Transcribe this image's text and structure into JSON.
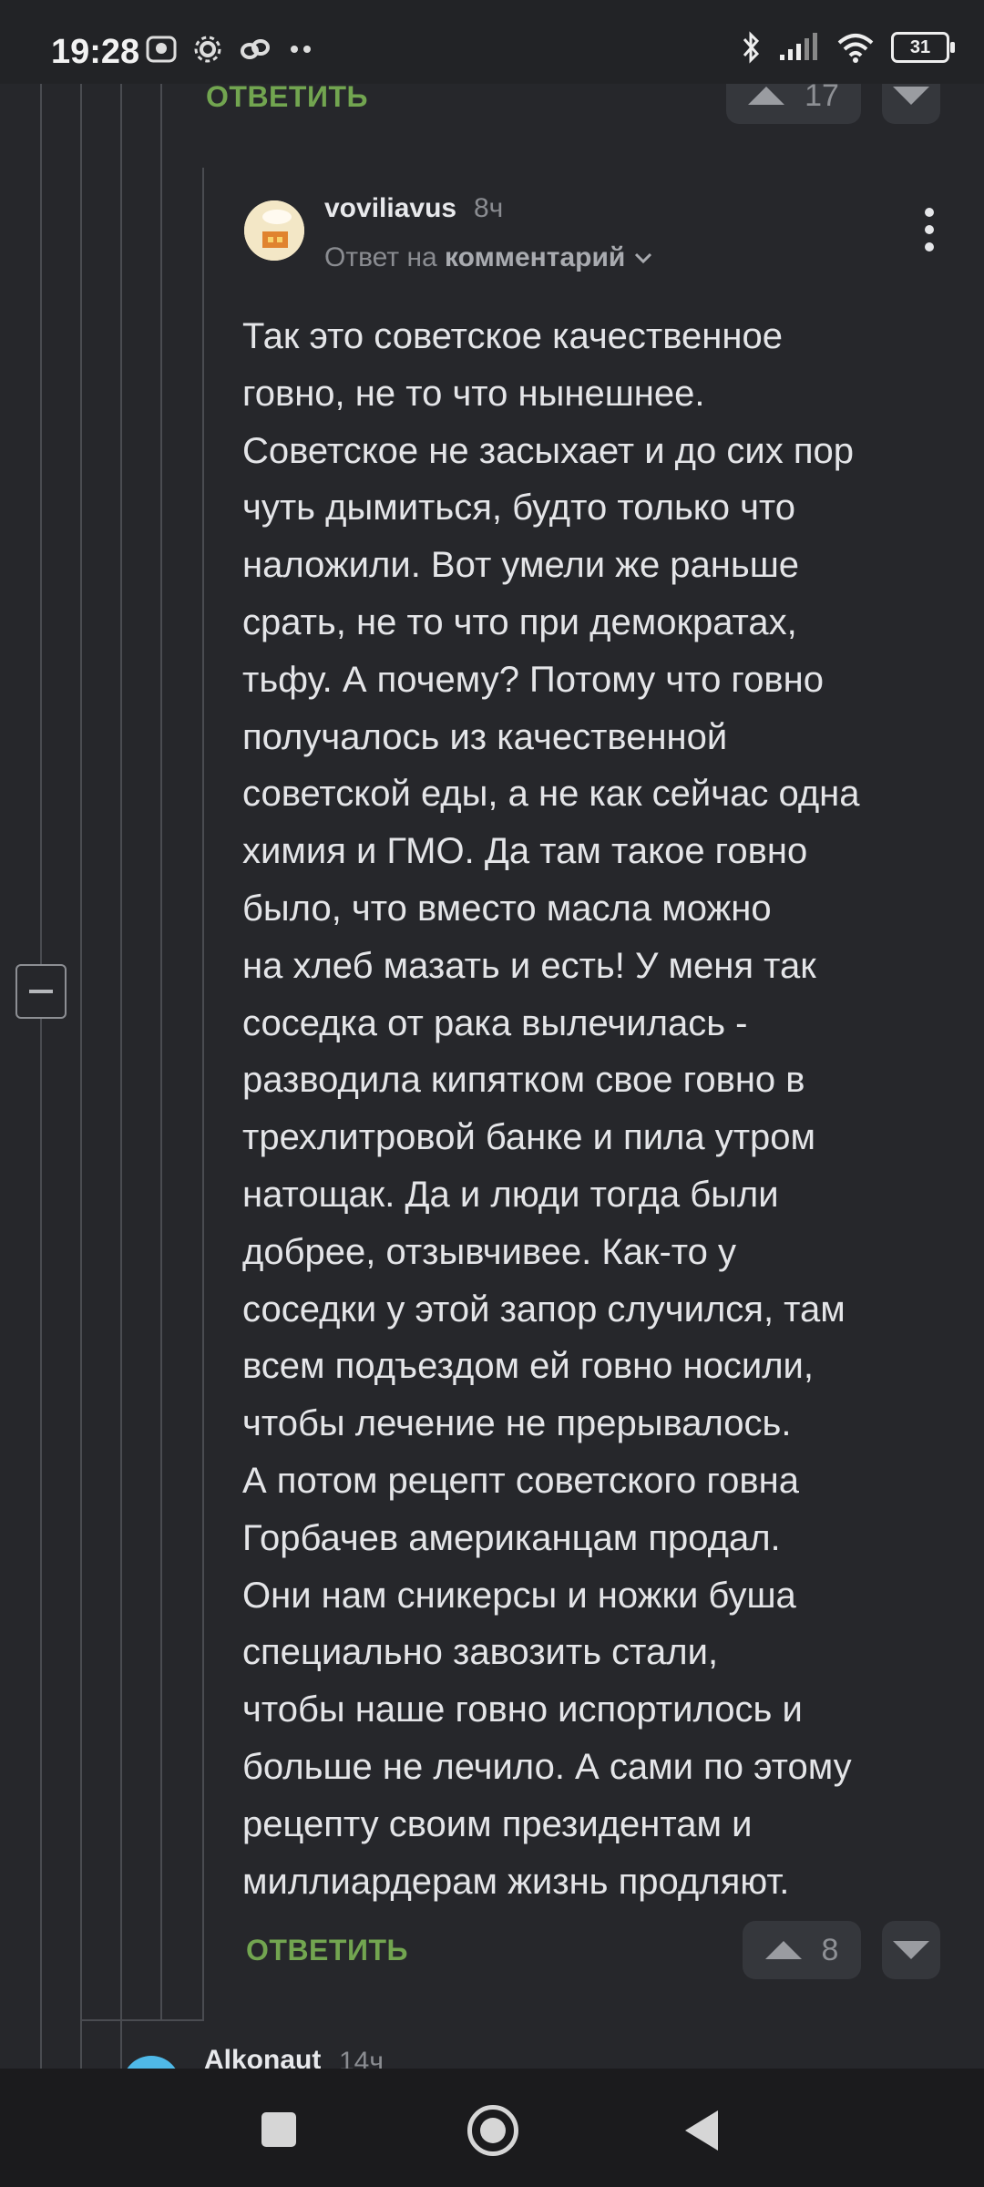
{
  "status_bar": {
    "time": "19:28",
    "battery": "31",
    "icons": [
      "photo-icon",
      "gear-icon",
      "link-icon",
      "more-dots-icon",
      "bluetooth-icon",
      "signal-icon",
      "wifi-icon",
      "battery-icon"
    ]
  },
  "prev_comment": {
    "reply_label": "ОТВЕТИТЬ",
    "score": "17"
  },
  "comment": {
    "username": "voviliavus",
    "time_ago": "8ч",
    "reply_prefix": "Ответ на",
    "reply_target": "комментарий",
    "text_lines": [
      "Так это советское качественное",
      "говно, не то что нынешнее.",
      "Советское не засыхает и до сих пор",
      "чуть дымиться, будто только что",
      "наложили. Вот умели же раньше",
      "срать, не то что при демократах,",
      "тьфу. А почему? Потому что говно",
      "получалось из качественной",
      "советской еды, а не как сейчас одна",
      "химия и ГМО. Да там такое говно",
      "было, что вместо масла можно",
      "на хлеб мазать и есть! У меня так",
      "соседка от рака вылечилась -",
      "разводила кипятком свое говно в",
      "трехлитровой банке и пила утром",
      "натощак. Да и люди тогда были",
      "добрее, отзывчивее. Как-то у",
      "соседки у этой запор случился, там",
      "всем подъездом ей говно носили,",
      "чтобы лечение не прерывалось.",
      "А потом рецепт советского говна",
      "Горбачев американцам продал.",
      "Они нам сникерсы и ножки буша",
      "специально завозить стали,",
      "чтобы наше говно испортилось и",
      "больше не лечило. А сами по этому",
      "рецепту своим президентам и",
      "миллиардерам жизнь продляют."
    ],
    "reply_label": "ОТВЕТИТЬ",
    "score": "8"
  },
  "next_comment": {
    "username": "Alkonaut",
    "time_ago": "14ч"
  },
  "colors": {
    "background": "#26272b",
    "reply_green": "#72a550",
    "vote_box": "#35373c"
  }
}
